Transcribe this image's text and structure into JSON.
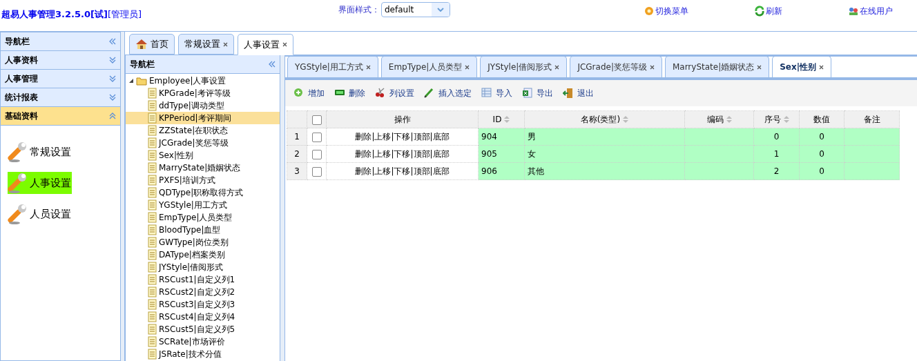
{
  "header": {
    "title": "超易人事管理3.2.5.0[试]",
    "role": "[管理员]",
    "style_label": "界面样式：",
    "style_select": {
      "value": "default"
    },
    "actions": [
      {
        "kind": "switch",
        "label": "切换菜单"
      },
      {
        "kind": "refresh",
        "label": "刷新"
      },
      {
        "kind": "users",
        "label": "在线用户"
      }
    ]
  },
  "sidebar": {
    "title": "导航栏",
    "sections": [
      {
        "label": "人事资料",
        "selected": false
      },
      {
        "label": "人事管理",
        "selected": false
      },
      {
        "label": "统计报表",
        "selected": false
      },
      {
        "label": "基础资料",
        "selected": true
      }
    ],
    "items": [
      {
        "label": "常规设置",
        "selected": false
      },
      {
        "label": "人事设置",
        "selected": true
      },
      {
        "label": "人员设置",
        "selected": false
      }
    ]
  },
  "main_tabs": [
    {
      "kind": "home",
      "label": "首页",
      "selected": false,
      "closable": false
    },
    {
      "label": "常规设置",
      "selected": false,
      "closable": true
    },
    {
      "label": "人事设置",
      "selected": true,
      "closable": true
    }
  ],
  "tree_panel": {
    "title": "导航栏",
    "tree": [
      {
        "label": "Employee|人事设置",
        "expanded": true,
        "selected": false,
        "children": [
          {
            "label": "KPGrade|考评等级",
            "selected": false
          },
          {
            "label": "ddType|调动类型",
            "selected": false
          },
          {
            "label": "KPPeriod|考评期间",
            "selected": true
          },
          {
            "label": "ZZState|在职状态",
            "selected": false
          },
          {
            "label": "JCGrade|奖惩等级",
            "selected": false
          },
          {
            "label": "Sex|性别",
            "selected": false
          },
          {
            "label": "MarryState|婚姻状态",
            "selected": false
          },
          {
            "label": "PXFS|培训方式",
            "selected": false
          },
          {
            "label": "QDType|职称取得方式",
            "selected": false
          },
          {
            "label": "YGStyle|用工方式",
            "selected": false
          },
          {
            "label": "EmpType|人员类型",
            "selected": false
          },
          {
            "label": "BloodType|血型",
            "selected": false
          },
          {
            "label": "GWType|岗位类别",
            "selected": false
          },
          {
            "label": "DAType|档案类别",
            "selected": false
          },
          {
            "label": "JYStyle|借阅形式",
            "selected": false
          },
          {
            "label": "RSCust1|自定义列1",
            "selected": false
          },
          {
            "label": "RSCust2|自定义列2",
            "selected": false
          },
          {
            "label": "RSCust3|自定义列3",
            "selected": false
          },
          {
            "label": "RSCust4|自定义列4",
            "selected": false
          },
          {
            "label": "RSCust5|自定义列5",
            "selected": false
          },
          {
            "label": "SCRate|市场评价",
            "selected": false
          },
          {
            "label": "JSRate|技术分值",
            "selected": false
          }
        ]
      }
    ]
  },
  "content_tabs": [
    {
      "label": "YGStyle|用工方式",
      "selected": false
    },
    {
      "label": "EmpType|人员类型",
      "selected": false
    },
    {
      "label": "JYStyle|借阅形式",
      "selected": false
    },
    {
      "label": "JCGrade|奖惩等级",
      "selected": false
    },
    {
      "label": "MarryState|婚姻状态",
      "selected": false
    },
    {
      "label": "Sex|性别",
      "selected": true
    }
  ],
  "toolbar": [
    {
      "kind": "add",
      "label": "增加"
    },
    {
      "kind": "delete",
      "label": "删除"
    },
    {
      "kind": "columns",
      "label": "列设置"
    },
    {
      "kind": "insert",
      "label": "插入选定"
    },
    {
      "kind": "import",
      "label": "导入"
    },
    {
      "kind": "export",
      "label": "导出"
    },
    {
      "kind": "exit",
      "label": "退出"
    }
  ],
  "table": {
    "select_all_checked": false,
    "columns": [
      {
        "label": "操作",
        "sortable": false
      },
      {
        "label": "ID",
        "sortable": true
      },
      {
        "label": "名称(类型)",
        "sortable": true
      },
      {
        "label": "编码",
        "sortable": true
      },
      {
        "label": "序号",
        "sortable": true
      },
      {
        "label": "数值",
        "sortable": false
      },
      {
        "label": "备注",
        "sortable": false
      }
    ],
    "rows": [
      {
        "row_number": "1",
        "checked": false,
        "actions": "删除|上移|下移|顶部|底部",
        "id": "904",
        "name": "男",
        "sequence": "0",
        "value": "0"
      },
      {
        "row_number": "2",
        "checked": false,
        "actions": "删除|上移|下移|顶部|底部",
        "id": "905",
        "name": "女",
        "sequence": "1",
        "value": "0"
      },
      {
        "row_number": "3",
        "checked": false,
        "actions": "删除|上移|下移|顶部|底部",
        "id": "906",
        "name": "其他",
        "sequence": "2",
        "value": "0"
      }
    ]
  }
}
